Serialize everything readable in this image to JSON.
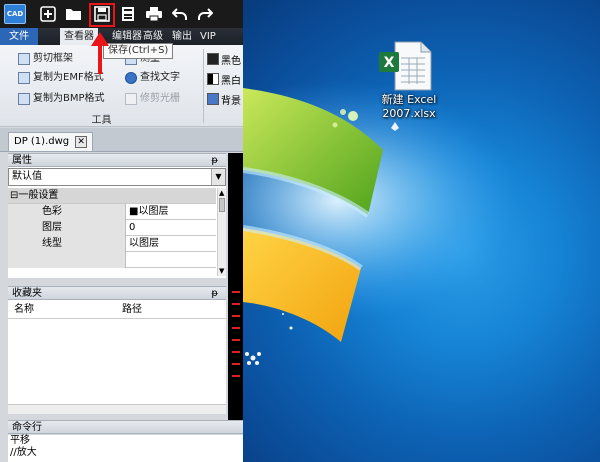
{
  "app": {
    "logo_text": "CAD",
    "quick_access": [
      "new-icon",
      "open-folder-icon",
      "save-icon",
      "save-as-icon",
      "print-icon",
      "undo-icon",
      "redo-icon"
    ],
    "tooltip": "保存(Ctrl+S)",
    "menu": {
      "file": "文件",
      "items": [
        "查看器",
        "编辑器",
        "高级",
        "输出",
        "VIP"
      ]
    },
    "ribbon": {
      "buttons": {
        "clip_frame": "剪切框架",
        "copy_emf": "复制为EMF格式",
        "copy_bmp": "复制为BMP格式",
        "measure": "测量",
        "find_text": "查找文字",
        "trim_raster": "修剪光栅"
      },
      "right_buttons": [
        "黑色",
        "黑白",
        "背景"
      ],
      "group_label": "工具"
    },
    "document_tab": "DP (1).dwg",
    "tab_close": "✕",
    "properties": {
      "title": "属性",
      "pin": "ᵽ",
      "select_value": "默认值",
      "category": "⊟一般设置",
      "rows": [
        {
          "key": "色彩",
          "value": "■以图层"
        },
        {
          "key": "图层",
          "value": "0"
        },
        {
          "key": "线型",
          "value": "以图层"
        }
      ]
    },
    "favorites": {
      "title": "收藏夹",
      "pin": "ᵽ",
      "columns": [
        "名称",
        "路径"
      ]
    },
    "command": {
      "title": "命令行",
      "lines": [
        "平移",
        "//放大"
      ]
    }
  },
  "desktop": {
    "file_name": "新建 Excel 2007.xlsx",
    "colors": {
      "accent_red": "#e8151b",
      "excel_green": "#1e7a3c",
      "wallpaper_blue": "#1683d4"
    }
  }
}
